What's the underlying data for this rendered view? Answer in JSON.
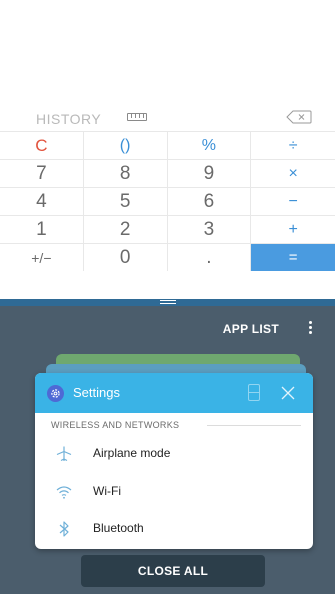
{
  "calculator": {
    "history_label": "HISTORY",
    "icons": {
      "converter": "ruler-icon",
      "backspace": "backspace-icon"
    },
    "keys": [
      "C",
      "()",
      "%",
      "÷",
      "7",
      "8",
      "9",
      "×",
      "4",
      "5",
      "6",
      "−",
      "1",
      "2",
      "3",
      "+",
      "+/−",
      "0",
      ".",
      "="
    ]
  },
  "recents": {
    "app_list_label": "APP LIST",
    "card": {
      "title": "Settings",
      "section_title": "WIRELESS AND NETWORKS",
      "items": [
        {
          "label": "Airplane mode",
          "icon": "airplane-icon"
        },
        {
          "label": "Wi-Fi",
          "icon": "wifi-icon"
        },
        {
          "label": "Bluetooth",
          "icon": "bluetooth-icon"
        }
      ]
    },
    "close_all_label": "CLOSE ALL"
  },
  "colors": {
    "accent": "#4a9be0",
    "clear": "#e2533d",
    "settings_header": "#3ab3e6",
    "recents_bg": "#4b5d6c"
  }
}
